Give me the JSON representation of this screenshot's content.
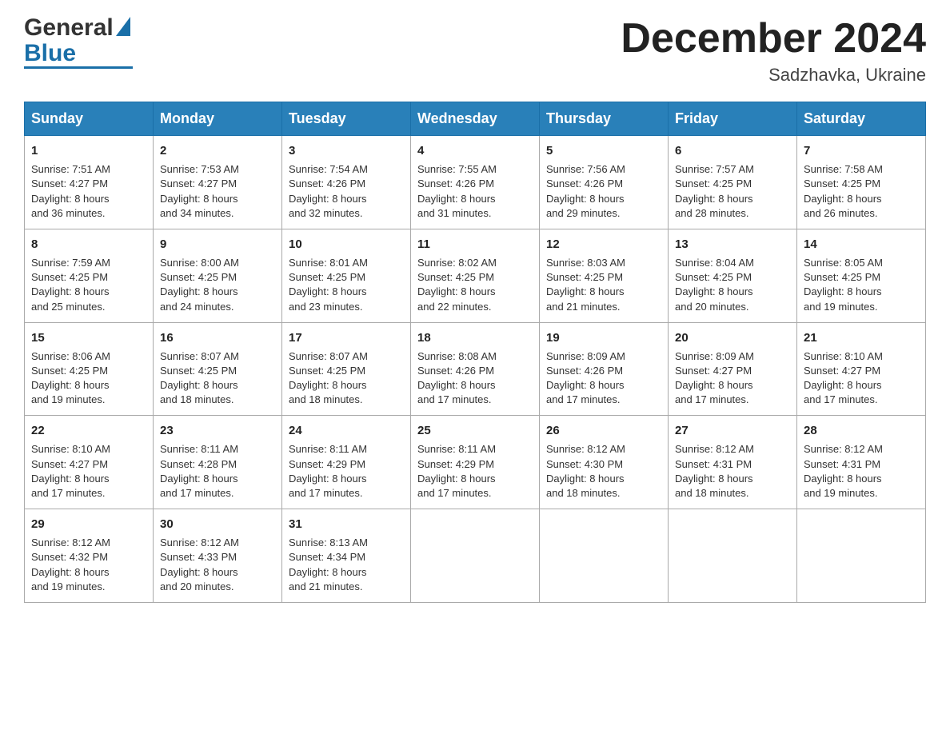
{
  "logo": {
    "text1": "General",
    "text2": "Blue"
  },
  "title": {
    "month_year": "December 2024",
    "location": "Sadzhavka, Ukraine"
  },
  "days_of_week": [
    "Sunday",
    "Monday",
    "Tuesday",
    "Wednesday",
    "Thursday",
    "Friday",
    "Saturday"
  ],
  "weeks": [
    [
      {
        "day": "1",
        "sunrise": "7:51 AM",
        "sunset": "4:27 PM",
        "daylight": "8 hours and 36 minutes."
      },
      {
        "day": "2",
        "sunrise": "7:53 AM",
        "sunset": "4:27 PM",
        "daylight": "8 hours and 34 minutes."
      },
      {
        "day": "3",
        "sunrise": "7:54 AM",
        "sunset": "4:26 PM",
        "daylight": "8 hours and 32 minutes."
      },
      {
        "day": "4",
        "sunrise": "7:55 AM",
        "sunset": "4:26 PM",
        "daylight": "8 hours and 31 minutes."
      },
      {
        "day": "5",
        "sunrise": "7:56 AM",
        "sunset": "4:26 PM",
        "daylight": "8 hours and 29 minutes."
      },
      {
        "day": "6",
        "sunrise": "7:57 AM",
        "sunset": "4:25 PM",
        "daylight": "8 hours and 28 minutes."
      },
      {
        "day": "7",
        "sunrise": "7:58 AM",
        "sunset": "4:25 PM",
        "daylight": "8 hours and 26 minutes."
      }
    ],
    [
      {
        "day": "8",
        "sunrise": "7:59 AM",
        "sunset": "4:25 PM",
        "daylight": "8 hours and 25 minutes."
      },
      {
        "day": "9",
        "sunrise": "8:00 AM",
        "sunset": "4:25 PM",
        "daylight": "8 hours and 24 minutes."
      },
      {
        "day": "10",
        "sunrise": "8:01 AM",
        "sunset": "4:25 PM",
        "daylight": "8 hours and 23 minutes."
      },
      {
        "day": "11",
        "sunrise": "8:02 AM",
        "sunset": "4:25 PM",
        "daylight": "8 hours and 22 minutes."
      },
      {
        "day": "12",
        "sunrise": "8:03 AM",
        "sunset": "4:25 PM",
        "daylight": "8 hours and 21 minutes."
      },
      {
        "day": "13",
        "sunrise": "8:04 AM",
        "sunset": "4:25 PM",
        "daylight": "8 hours and 20 minutes."
      },
      {
        "day": "14",
        "sunrise": "8:05 AM",
        "sunset": "4:25 PM",
        "daylight": "8 hours and 19 minutes."
      }
    ],
    [
      {
        "day": "15",
        "sunrise": "8:06 AM",
        "sunset": "4:25 PM",
        "daylight": "8 hours and 19 minutes."
      },
      {
        "day": "16",
        "sunrise": "8:07 AM",
        "sunset": "4:25 PM",
        "daylight": "8 hours and 18 minutes."
      },
      {
        "day": "17",
        "sunrise": "8:07 AM",
        "sunset": "4:25 PM",
        "daylight": "8 hours and 18 minutes."
      },
      {
        "day": "18",
        "sunrise": "8:08 AM",
        "sunset": "4:26 PM",
        "daylight": "8 hours and 17 minutes."
      },
      {
        "day": "19",
        "sunrise": "8:09 AM",
        "sunset": "4:26 PM",
        "daylight": "8 hours and 17 minutes."
      },
      {
        "day": "20",
        "sunrise": "8:09 AM",
        "sunset": "4:27 PM",
        "daylight": "8 hours and 17 minutes."
      },
      {
        "day": "21",
        "sunrise": "8:10 AM",
        "sunset": "4:27 PM",
        "daylight": "8 hours and 17 minutes."
      }
    ],
    [
      {
        "day": "22",
        "sunrise": "8:10 AM",
        "sunset": "4:27 PM",
        "daylight": "8 hours and 17 minutes."
      },
      {
        "day": "23",
        "sunrise": "8:11 AM",
        "sunset": "4:28 PM",
        "daylight": "8 hours and 17 minutes."
      },
      {
        "day": "24",
        "sunrise": "8:11 AM",
        "sunset": "4:29 PM",
        "daylight": "8 hours and 17 minutes."
      },
      {
        "day": "25",
        "sunrise": "8:11 AM",
        "sunset": "4:29 PM",
        "daylight": "8 hours and 17 minutes."
      },
      {
        "day": "26",
        "sunrise": "8:12 AM",
        "sunset": "4:30 PM",
        "daylight": "8 hours and 18 minutes."
      },
      {
        "day": "27",
        "sunrise": "8:12 AM",
        "sunset": "4:31 PM",
        "daylight": "8 hours and 18 minutes."
      },
      {
        "day": "28",
        "sunrise": "8:12 AM",
        "sunset": "4:31 PM",
        "daylight": "8 hours and 19 minutes."
      }
    ],
    [
      {
        "day": "29",
        "sunrise": "8:12 AM",
        "sunset": "4:32 PM",
        "daylight": "8 hours and 19 minutes."
      },
      {
        "day": "30",
        "sunrise": "8:12 AM",
        "sunset": "4:33 PM",
        "daylight": "8 hours and 20 minutes."
      },
      {
        "day": "31",
        "sunrise": "8:13 AM",
        "sunset": "4:34 PM",
        "daylight": "8 hours and 21 minutes."
      },
      null,
      null,
      null,
      null
    ]
  ],
  "cell_labels": {
    "sunrise": "Sunrise:",
    "sunset": "Sunset:",
    "daylight": "Daylight:"
  }
}
